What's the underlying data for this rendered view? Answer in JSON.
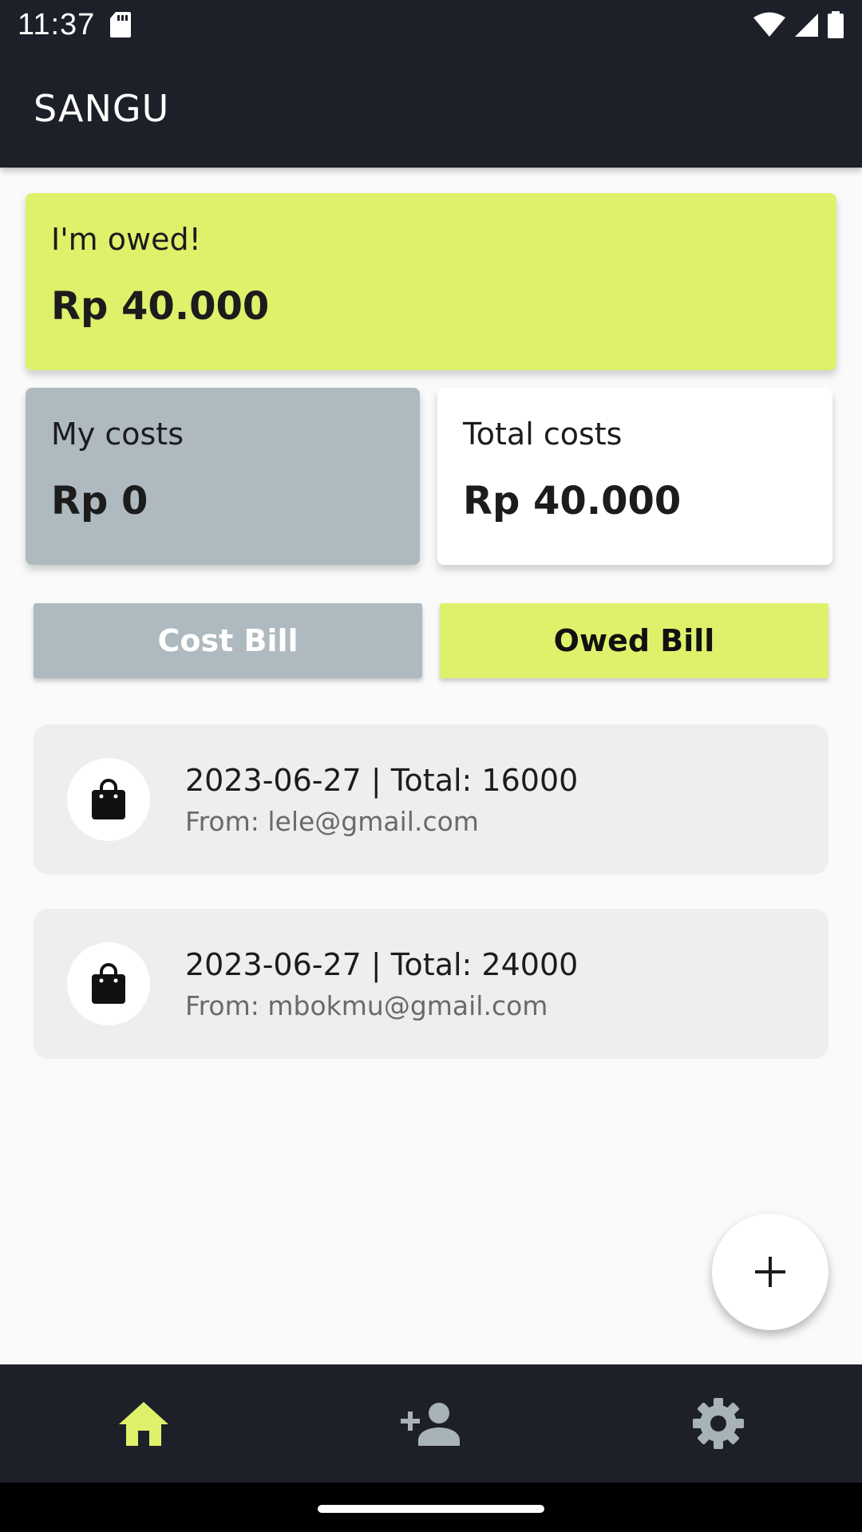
{
  "status_bar": {
    "time": "11:37",
    "icons": [
      "sd-card-icon",
      "wifi-icon",
      "cellular-signal-icon",
      "battery-icon"
    ]
  },
  "app_bar": {
    "title": "SANGU"
  },
  "summary": {
    "owed": {
      "label": "I'm owed!",
      "value": "Rp 40.000"
    },
    "my_costs": {
      "label": "My costs",
      "value": "Rp 0"
    },
    "total_costs": {
      "label": "Total costs",
      "value": "Rp 40.000"
    }
  },
  "tabs": {
    "cost_bill": "Cost Bill",
    "owed_bill": "Owed Bill"
  },
  "bills": [
    {
      "title": "2023-06-27 | Total: 16000",
      "from": "From: lele@gmail.com",
      "icon": "shopping-bag-icon"
    },
    {
      "title": "2023-06-27 | Total: 24000",
      "from": "From: mbokmu@gmail.com",
      "icon": "shopping-bag-icon"
    }
  ],
  "fab": {
    "icon": "plus-icon"
  },
  "bottom_nav": [
    {
      "icon": "home-icon",
      "active": true
    },
    {
      "icon": "add-person-icon",
      "active": false
    },
    {
      "icon": "settings-icon",
      "active": false
    }
  ],
  "colors": {
    "accent": "#dff16b",
    "muted": "#aebac0",
    "dark": "#1e2029",
    "inactive_icon": "#a7b3b9"
  }
}
